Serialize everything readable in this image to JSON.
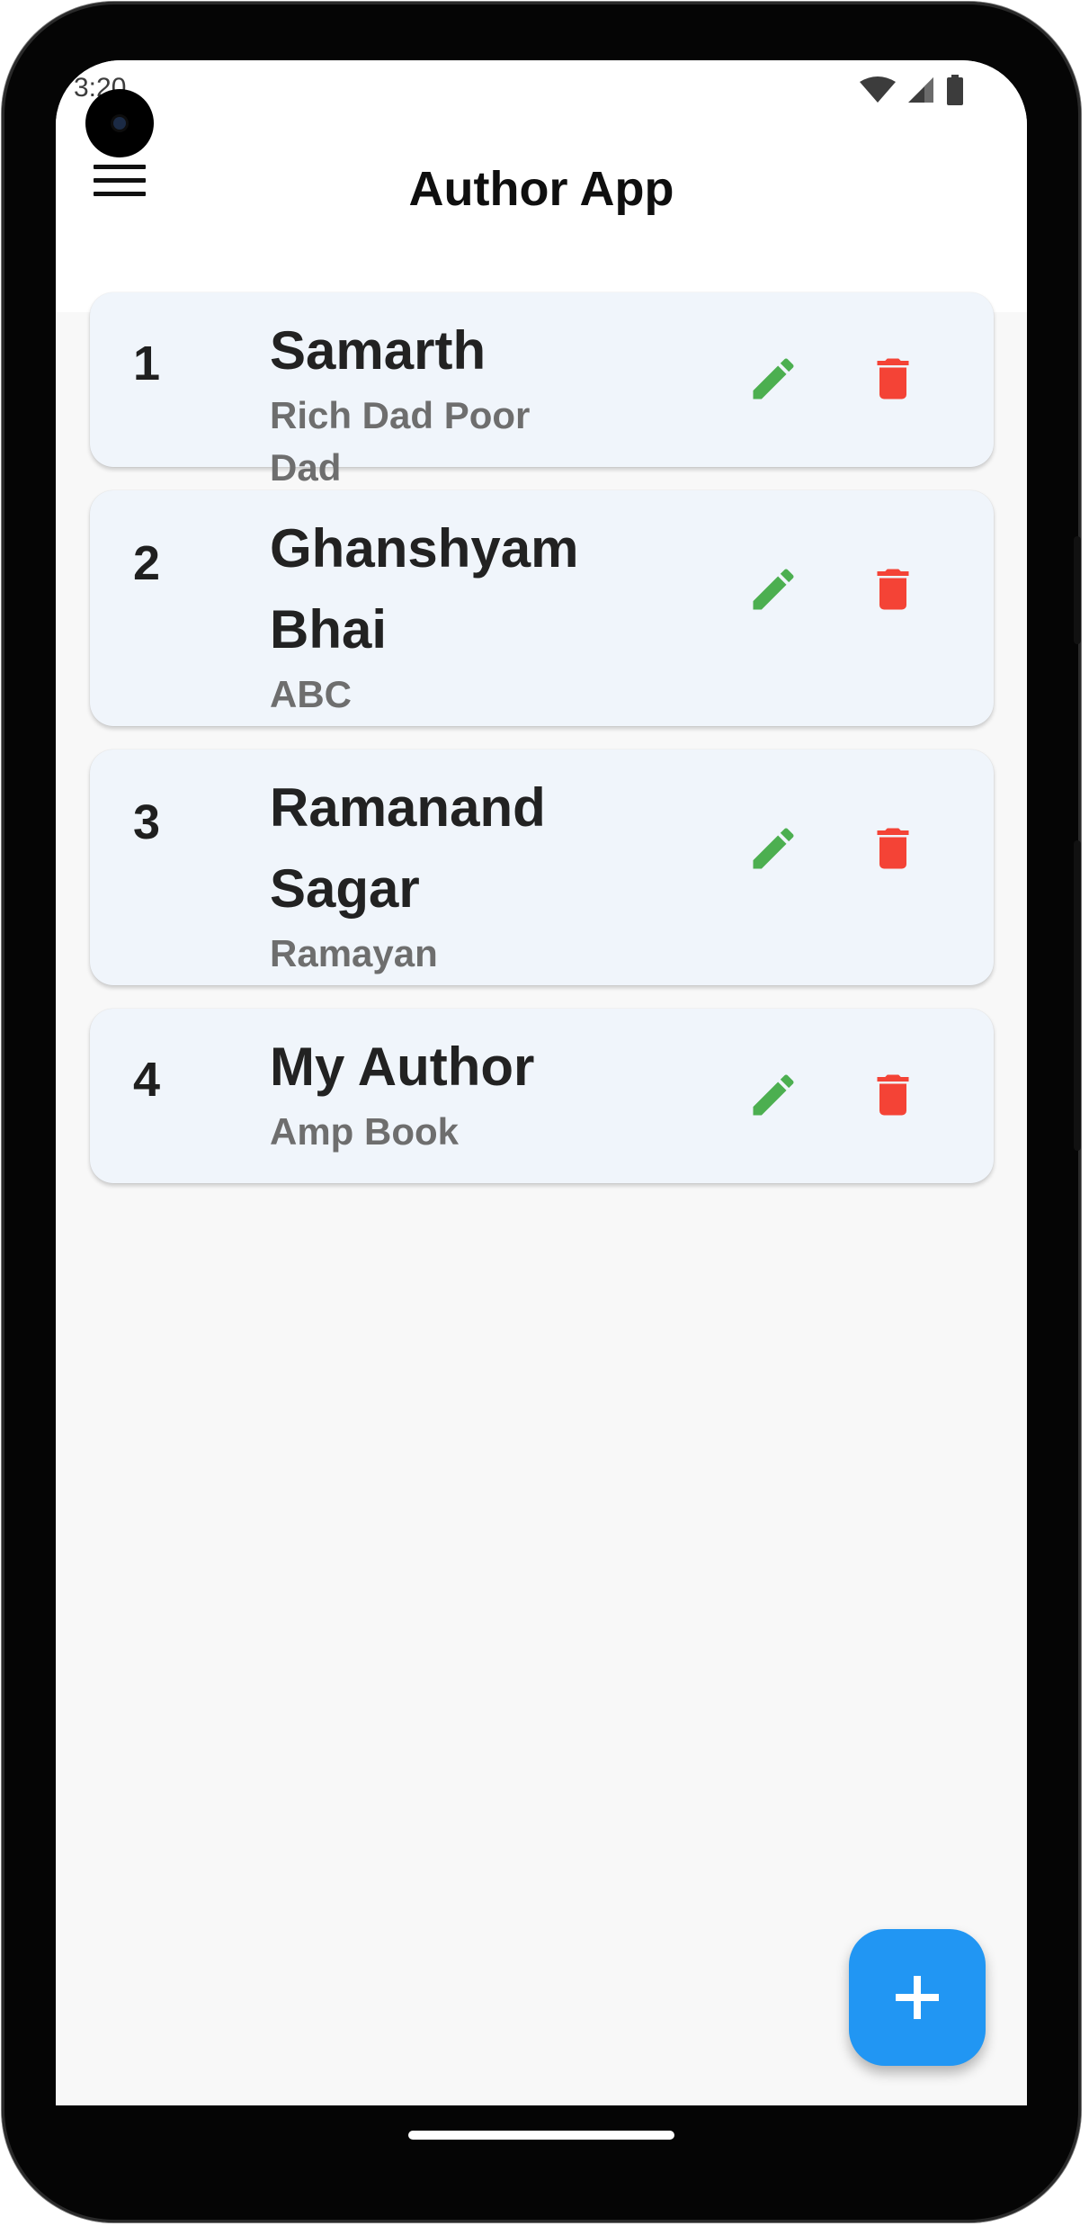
{
  "status_bar": {
    "time": "3:20",
    "icons": [
      "wifi-icon",
      "signal-icon",
      "battery-icon"
    ]
  },
  "app_bar": {
    "title": "Author App",
    "menu_icon": "hamburger-menu-icon"
  },
  "authors": [
    {
      "index": "1",
      "name": "Samarth",
      "book": "Rich Dad Poor Dad"
    },
    {
      "index": "2",
      "name": "Ghanshyam Bhai",
      "book": "ABC"
    },
    {
      "index": "3",
      "name": "Ramanand Sagar",
      "book": "Ramayan"
    },
    {
      "index": "4",
      "name": "My Author",
      "book": "Amp Book"
    }
  ],
  "row_actions": {
    "edit_icon": "pencil-icon",
    "delete_icon": "trash-icon"
  },
  "fab": {
    "icon": "plus-icon"
  },
  "colors": {
    "edit": "#4caf50",
    "delete": "#f44336",
    "fab": "#2196f3",
    "card_background": "#f0f5fb"
  }
}
